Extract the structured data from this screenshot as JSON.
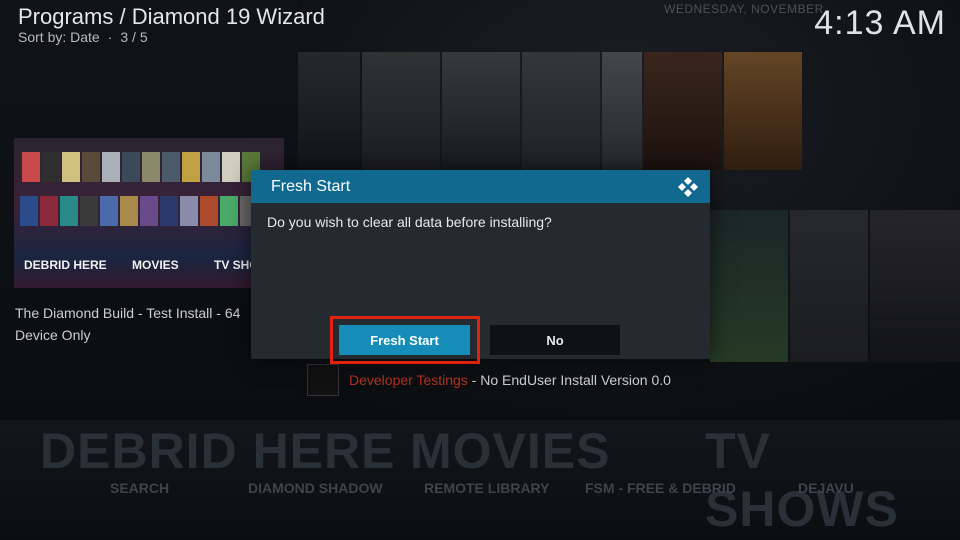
{
  "header": {
    "title": "Programs / Diamond 19 Wizard",
    "sort_label": "Sort by: Date",
    "position": "3 / 5",
    "date": "WEDNESDAY, NOVEMBER",
    "clock": "4:13 AM"
  },
  "fanart": {
    "labels": [
      "DEBRID HERE",
      "MOVIES",
      "TV SHOWS"
    ]
  },
  "item_description": "The Diamond Build - Test Install - 64 Device Only",
  "list_row": {
    "highlight": "Developer Testings",
    "text": " - No EndUser Install Version 0.0"
  },
  "bottom_band": {
    "words": [
      "DEBRID HERE",
      "MOVIES",
      "TV SHOWS"
    ],
    "subs": [
      "SEARCH",
      "DIAMOND SHADOW",
      "REMOTE LIBRARY",
      "FSM - FREE & DEBRID",
      "DEJAVU"
    ]
  },
  "dialog": {
    "title": "Fresh Start",
    "message": "Do you wish to clear all data before installing?",
    "buttons": {
      "fresh_start": "Fresh Start",
      "no": "No"
    }
  },
  "colors": {
    "dialog_header": "#12698f",
    "focused_button": "#168cb8",
    "highlight_box": "#e1220e",
    "developer_text": "#b3311f"
  }
}
